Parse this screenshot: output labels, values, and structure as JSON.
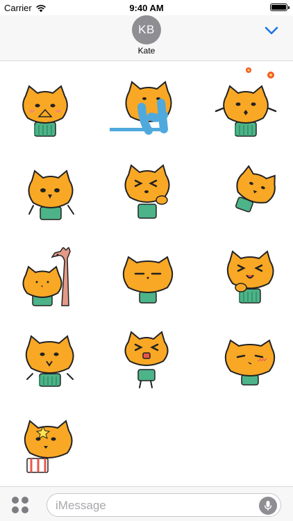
{
  "status_bar": {
    "carrier": "Carrier",
    "time": "9:40 AM",
    "icons": [
      "wifi-icon",
      "battery-icon"
    ]
  },
  "header": {
    "avatar_initials": "KB",
    "contact_name": "Kate",
    "collapse_icon": "chevron-down-icon"
  },
  "stickers": [
    {
      "icon": "cat-praying-sticker"
    },
    {
      "icon": "cat-blue-arms-sticker"
    },
    {
      "icon": "cat-flowers-sticker"
    },
    {
      "icon": "cat-waving-sticker"
    },
    {
      "icon": "cat-squint-sticker"
    },
    {
      "icon": "cat-tilted-sticker"
    },
    {
      "icon": "cat-giraffe-sticker"
    },
    {
      "icon": "cat-sleepy-sticker"
    },
    {
      "icon": "cat-laughing-sticker"
    },
    {
      "icon": "cat-shrug-sticker"
    },
    {
      "icon": "cat-jumping-sticker"
    },
    {
      "icon": "cat-blushing-sticker"
    },
    {
      "icon": "cat-popcorn-sticker"
    }
  ],
  "composer": {
    "placeholder": "iMessage",
    "apps_icon": "apps-grid-icon",
    "mic_icon": "microphone-icon"
  },
  "colors": {
    "cat_orange": "#F9A825",
    "shirt_green": "#4DB388",
    "accent_blue": "#1A73E8",
    "avatar_gray": "#8E8E93"
  }
}
